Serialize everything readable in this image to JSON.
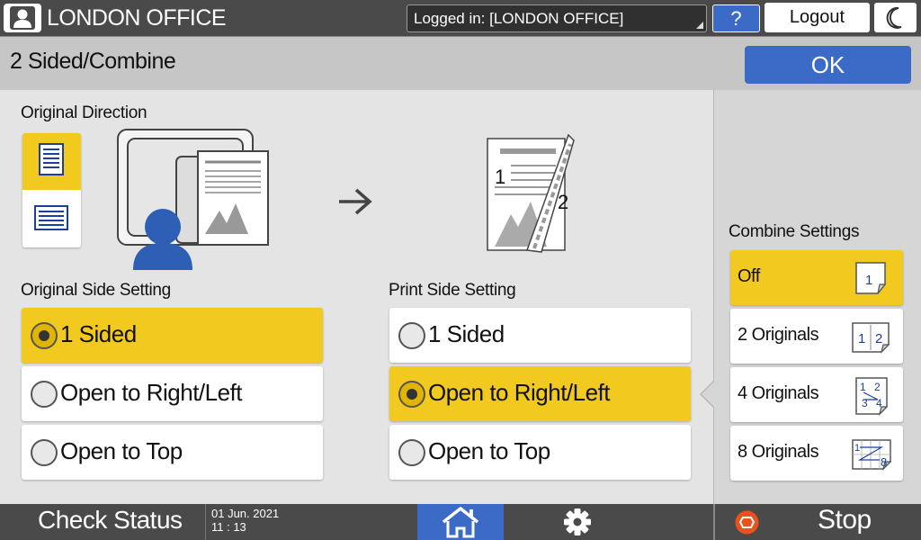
{
  "header": {
    "office_title": "LONDON OFFICE",
    "login_status": "Logged in: [LONDON OFFICE]",
    "help_label": "?",
    "logout_label": "Logout"
  },
  "title_bar": {
    "title": "2 Sided/Combine",
    "ok_label": "OK"
  },
  "original_direction": {
    "label": "Original Direction",
    "options": [
      {
        "icon": "portrait-orientation-icon",
        "selected": true
      },
      {
        "icon": "landscape-orientation-icon",
        "selected": false
      }
    ]
  },
  "preview": {
    "page_numbers": [
      "1",
      "2"
    ]
  },
  "original_side_setting": {
    "label": "Original Side Setting",
    "options": [
      {
        "label": "1 Sided",
        "selected": true
      },
      {
        "label": "Open to Right/Left",
        "selected": false
      },
      {
        "label": "Open to Top",
        "selected": false
      }
    ]
  },
  "print_side_setting": {
    "label": "Print Side Setting",
    "options": [
      {
        "label": "1 Sided",
        "selected": false
      },
      {
        "label": "Open to Right/Left",
        "selected": true
      },
      {
        "label": "Open to Top",
        "selected": false
      }
    ]
  },
  "combine_settings": {
    "label": "Combine Settings",
    "options": [
      {
        "label": "Off",
        "selected": true
      },
      {
        "label": "2 Originals",
        "selected": false
      },
      {
        "label": "4 Originals",
        "selected": false
      },
      {
        "label": "8 Originals",
        "selected": false
      }
    ]
  },
  "footer": {
    "check_status": "Check Status",
    "date": "01 Jun. 2021",
    "time": "11 : 13",
    "stop_label": "Stop"
  },
  "colors": {
    "accent_blue": "#3b6bc6",
    "selected_yellow": "#f2c91f",
    "bar_gray": "#4a4a4a"
  }
}
